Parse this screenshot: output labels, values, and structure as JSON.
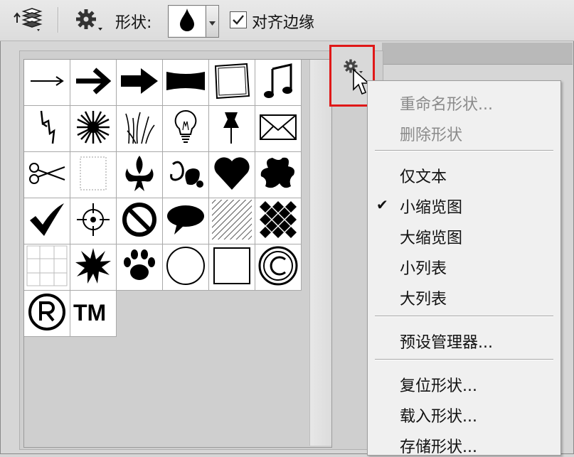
{
  "toolbar": {
    "shape_label": "形状:",
    "align_label": "对齐边缘",
    "align_checked": true
  },
  "shape_grid": {
    "cells": [
      {
        "name": "thin-arrow",
        "glyph": "→"
      },
      {
        "name": "bold-arrow",
        "glyph": "➔"
      },
      {
        "name": "fat-arrow",
        "glyph": "➡"
      },
      {
        "name": "banner",
        "glyph": ""
      },
      {
        "name": "frame",
        "glyph": ""
      },
      {
        "name": "music-note",
        "glyph": "♫"
      },
      {
        "name": "lightning",
        "glyph": "ϟ"
      },
      {
        "name": "burst",
        "glyph": "✹"
      },
      {
        "name": "grass",
        "glyph": "⺌"
      },
      {
        "name": "light-bulb",
        "glyph": "💡"
      },
      {
        "name": "pushpin",
        "glyph": "📌"
      },
      {
        "name": "envelope",
        "glyph": "✉"
      },
      {
        "name": "scissors",
        "glyph": "✂"
      },
      {
        "name": "stamp",
        "glyph": ""
      },
      {
        "name": "fleur-de-lis",
        "glyph": "⚜"
      },
      {
        "name": "ornament",
        "glyph": "❦"
      },
      {
        "name": "heart",
        "glyph": "♥"
      },
      {
        "name": "splat",
        "glyph": "✱"
      },
      {
        "name": "checkmark",
        "glyph": "✔"
      },
      {
        "name": "target",
        "glyph": "⌖"
      },
      {
        "name": "no-sign",
        "glyph": "⃠"
      },
      {
        "name": "speech-bubble",
        "glyph": "💬"
      },
      {
        "name": "stripes",
        "glyph": ""
      },
      {
        "name": "checker",
        "glyph": "❖"
      },
      {
        "name": "grid",
        "glyph": ""
      },
      {
        "name": "starburst",
        "glyph": "✷"
      },
      {
        "name": "paw",
        "glyph": "🐾"
      },
      {
        "name": "circle",
        "glyph": "○"
      },
      {
        "name": "square",
        "glyph": "□"
      },
      {
        "name": "copyright",
        "glyph": "©"
      },
      {
        "name": "registered",
        "glyph": "®"
      },
      {
        "name": "trademark",
        "glyph": "TM"
      }
    ]
  },
  "menu": {
    "items": [
      {
        "label": "重命名形状...",
        "disabled": true
      },
      {
        "label": "删除形状",
        "disabled": true
      },
      {
        "label": "仅文本",
        "disabled": false
      },
      {
        "label": "小缩览图",
        "disabled": false,
        "checked": true
      },
      {
        "label": "大缩览图",
        "disabled": false
      },
      {
        "label": "小列表",
        "disabled": false
      },
      {
        "label": "大列表",
        "disabled": false
      },
      {
        "label": "预设管理器...",
        "disabled": false
      },
      {
        "label": "复位形状...",
        "disabled": false
      },
      {
        "label": "载入形状...",
        "disabled": false
      },
      {
        "label": "存储形状...",
        "disabled": false
      }
    ],
    "checkmark": "✔"
  },
  "colors": {
    "highlight_border": "#e01818"
  }
}
